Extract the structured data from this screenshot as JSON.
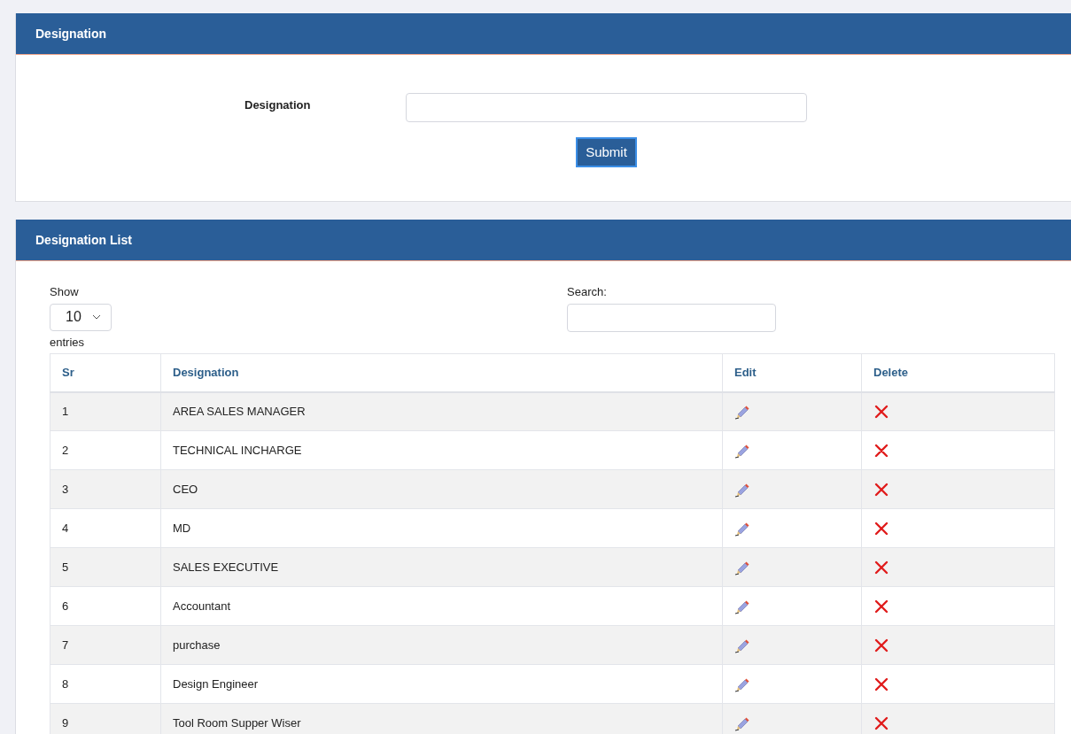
{
  "form_panel": {
    "title": "Designation",
    "field_label": "Designation",
    "submit": "Submit"
  },
  "list_panel": {
    "title": "Designation List",
    "show_label": "Show",
    "page_size": "10",
    "entries_label": "entries",
    "search_label": "Search:",
    "table": {
      "columns": [
        "Sr",
        "Designation",
        "Edit",
        "Delete"
      ],
      "rows": [
        {
          "sr": "1",
          "designation": "AREA SALES MANAGER"
        },
        {
          "sr": "2",
          "designation": "TECHNICAL INCHARGE"
        },
        {
          "sr": "3",
          "designation": "CEO"
        },
        {
          "sr": "4",
          "designation": "MD"
        },
        {
          "sr": "5",
          "designation": "SALES EXECUTIVE"
        },
        {
          "sr": "6",
          "designation": "Accountant"
        },
        {
          "sr": "7",
          "designation": "purchase"
        },
        {
          "sr": "8",
          "designation": "Design Engineer"
        },
        {
          "sr": "9",
          "designation": "Tool Room Supper Wiser"
        }
      ]
    }
  }
}
